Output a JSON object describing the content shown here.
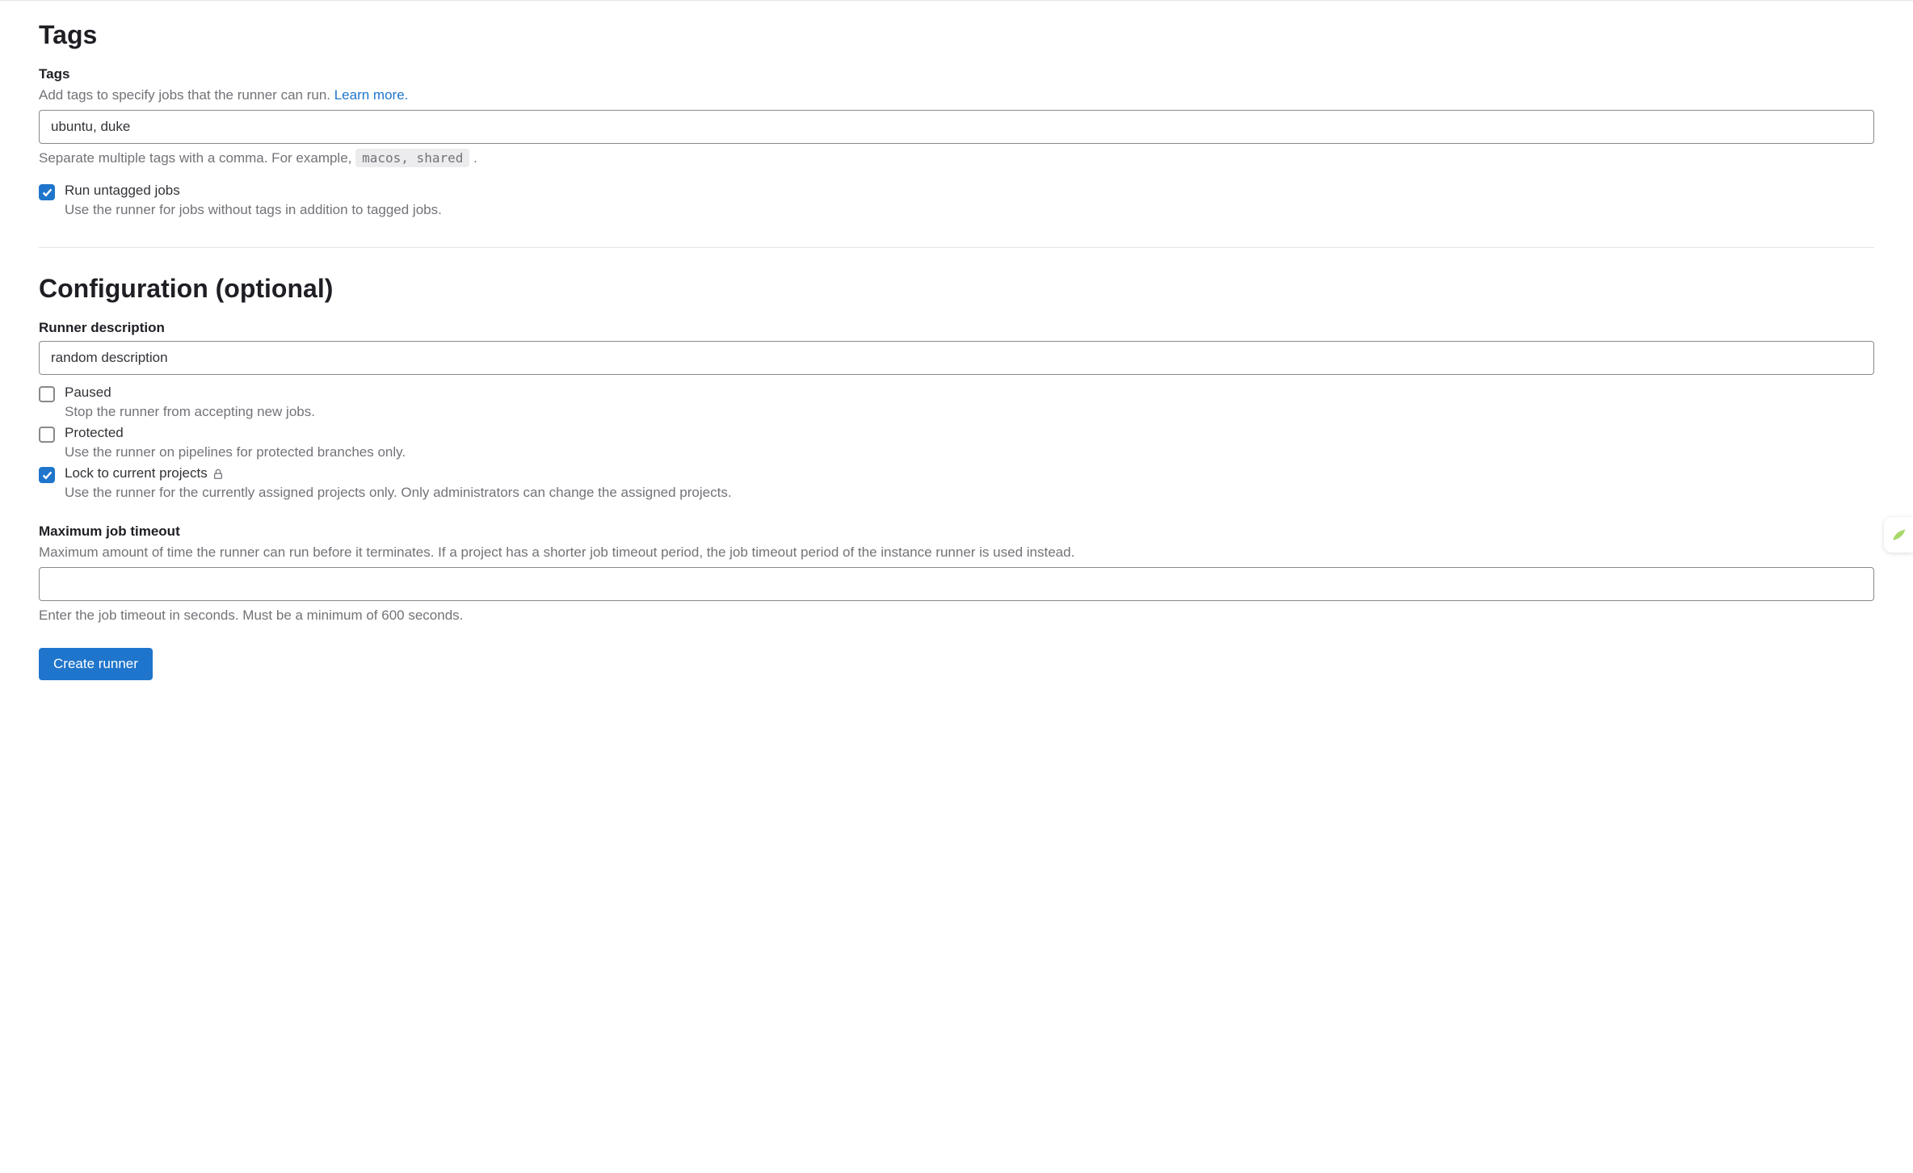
{
  "tags_section": {
    "heading": "Tags",
    "label": "Tags",
    "description_prefix": "Add tags to specify jobs that the runner can run. ",
    "learn_more": "Learn more.",
    "input_value": "ubuntu, duke",
    "help_prefix": "Separate multiple tags with a comma. For example, ",
    "help_code": "macos, shared",
    "help_suffix": " .",
    "untagged": {
      "label": "Run untagged jobs",
      "help": "Use the runner for jobs without tags in addition to tagged jobs."
    }
  },
  "config_section": {
    "heading": "Configuration (optional)",
    "description": {
      "label": "Runner description",
      "value": "random description"
    },
    "paused": {
      "label": "Paused",
      "help": "Stop the runner from accepting new jobs."
    },
    "protected": {
      "label": "Protected",
      "help": "Use the runner on pipelines for protected branches only."
    },
    "locked": {
      "label": "Lock to current projects",
      "help": "Use the runner for the currently assigned projects only. Only administrators can change the assigned projects."
    },
    "timeout": {
      "label": "Maximum job timeout",
      "description": "Maximum amount of time the runner can run before it terminates. If a project has a shorter job timeout period, the job timeout period of the instance runner is used instead.",
      "value": "",
      "help": "Enter the job timeout in seconds. Must be a minimum of 600 seconds."
    }
  },
  "submit_label": "Create runner"
}
